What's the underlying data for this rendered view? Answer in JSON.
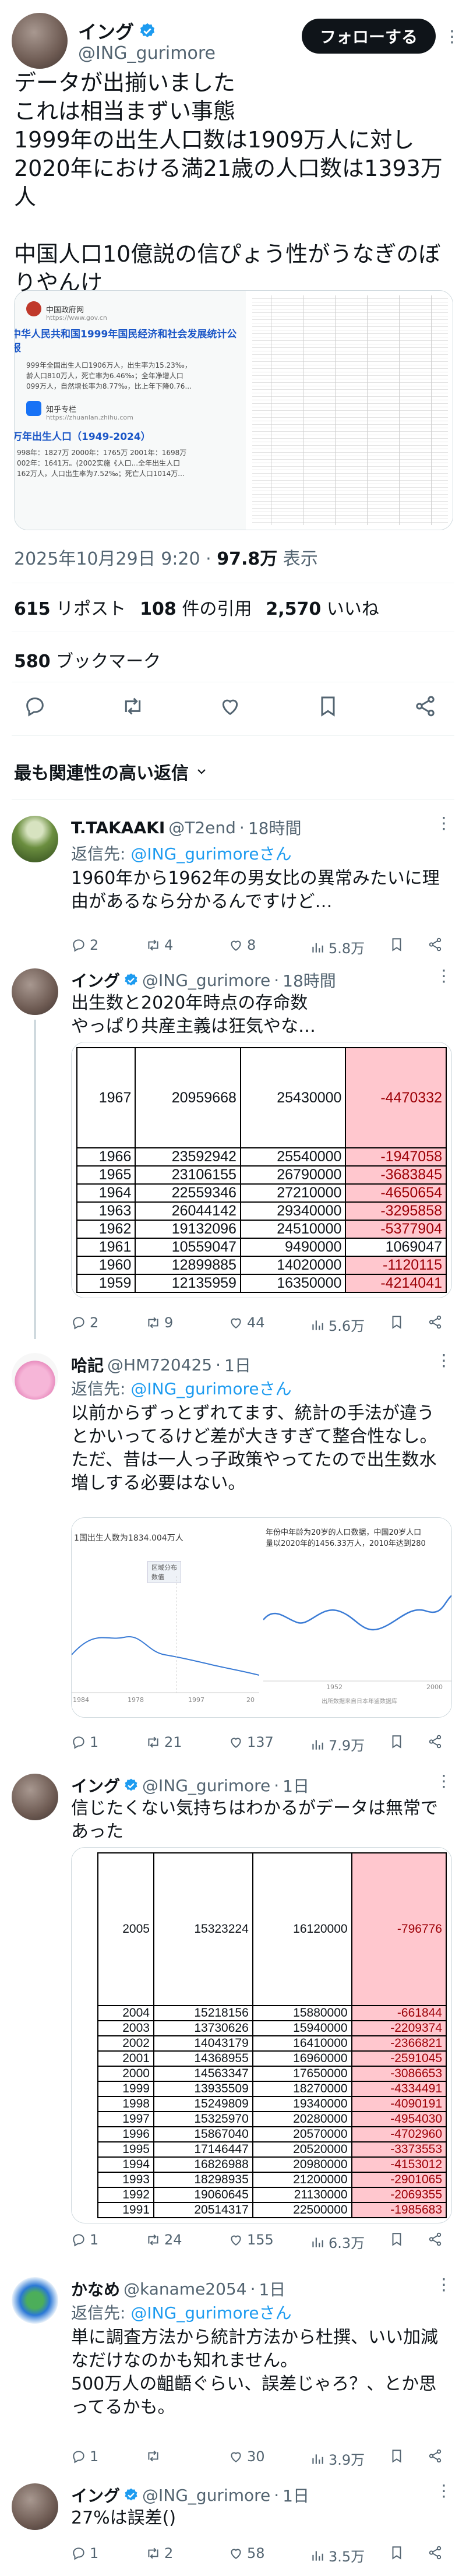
{
  "main": {
    "author_name": "イング",
    "author_handle": "@ING_gurimore",
    "follow_label": "フォローする",
    "text": "データが出揃いました\nこれは相当まずい事態\n1999年の出生人口数は1909万人に対し\n2020年における満21歳の人口数は1393万人\n\n中国人口10億説の信ぴょう性がうなぎのぼりやんけ",
    "timestamp": "2025年10月29日 9:20",
    "views": "97.8万",
    "views_label": "表示",
    "reposts": "615",
    "reposts_label": "リポスト",
    "quotes": "108",
    "quotes_label": "件の引用",
    "likes": "2,570",
    "likes_label": "いいね",
    "bookmarks": "580",
    "bookmarks_label": "ブックマーク",
    "media_left": {
      "site_name": "中国政府网",
      "site_url": "https://www.gov.cn",
      "title": "中华人民共和国1999年国民经济和社会发展统计公报",
      "body": "999年全国出生人口1906万人，出生率为15.23‰，\n龄人口810万人，死亡率为6.46‰；全年净增人口\n099万人，自然增长率为8.77‰，比上年下降0.76...",
      "site2_name": "知乎专栏",
      "site2_url": "https://zhuanlan.zhihu.com",
      "title2": "万年出生人口（1949-2024）",
      "body2": "998年：1827万 2000年：1765万 2001年：1698万\n002年：1641万。(2002实施《人口...全年出生人口\n162万人，人口出生率为7.52‰；死亡人口1014万..."
    }
  },
  "section_title": "最も関連性の高い返信",
  "replies": [
    {
      "name": "T.TAKAAKI",
      "handle": "@T2end",
      "time": "18時間",
      "reply_to_label": "返信先: ",
      "reply_to": "@ING_gurimoreさん",
      "text": "1960年から1962年の男女比の異常みたいに理由があるなら分かるんですけど…",
      "replies": "2",
      "reposts": "4",
      "likes": "8",
      "views": "5.8万"
    },
    {
      "name": "イング",
      "handle": "@ING_gurimore",
      "time": "18時間",
      "text": "出生数と2020年時点の存命数\nやっぱり共産主義は狂気やな…",
      "replies": "2",
      "reposts": "9",
      "likes": "44",
      "views": "5.6万",
      "table": [
        [
          "1967",
          "20959668",
          "25430000",
          "-4470332"
        ],
        [
          "1966",
          "23592942",
          "25540000",
          "-1947058"
        ],
        [
          "1965",
          "23106155",
          "26790000",
          "-3683845"
        ],
        [
          "1964",
          "22559346",
          "27210000",
          "-4650654"
        ],
        [
          "1963",
          "26044142",
          "29340000",
          "-3295858"
        ],
        [
          "1962",
          "19132096",
          "24510000",
          "-5377904"
        ],
        [
          "1961",
          "10559047",
          "9490000",
          "1069047"
        ],
        [
          "1960",
          "12899885",
          "14020000",
          "-1120115"
        ],
        [
          "1959",
          "12135959",
          "16350000",
          "-4214041"
        ]
      ]
    },
    {
      "name": "哈記",
      "handle": "@HM720425",
      "time": "1日",
      "reply_to_label": "返信先: ",
      "reply_to": "@ING_gurimoreさん",
      "text": "以前からずっとずれてます、統計の手法が違うとかいってるけど差が大きすぎて整合性なし。\nただ、昔は一人っ子政策やってたので出生数水増しする必要はない。",
      "replies": "1",
      "reposts": "21",
      "likes": "137",
      "views": "7.9万",
      "chart_left": {
        "title": "1国出生人数为1834.004万人",
        "label": "区域分布\n数值",
        "ticks": [
          "1984",
          "1978",
          "1997",
          "20"
        ]
      },
      "chart_right": {
        "title": "年份中年龄为20岁的人口数据，中国20岁人口\n量以2020年的1456.33万人，2010年达到280",
        "ticks": [
          "1952",
          "2000"
        ],
        "note": "出所数据来自日本年鉴数据库"
      }
    },
    {
      "name": "イング",
      "handle": "@ING_gurimore",
      "time": "1日",
      "text": "信じたくない気持ちはわかるがデータは無常であった",
      "replies": "1",
      "reposts": "24",
      "likes": "155",
      "views": "6.3万",
      "table": [
        [
          "2005",
          "15323224",
          "16120000",
          "-796776"
        ],
        [
          "2004",
          "15218156",
          "15880000",
          "-661844"
        ],
        [
          "2003",
          "13730626",
          "15940000",
          "-2209374"
        ],
        [
          "2002",
          "14043179",
          "16410000",
          "-2366821"
        ],
        [
          "2001",
          "14368955",
          "16960000",
          "-2591045"
        ],
        [
          "2000",
          "14563347",
          "17650000",
          "-3086653"
        ],
        [
          "1999",
          "13935509",
          "18270000",
          "-4334491"
        ],
        [
          "1998",
          "15249809",
          "19340000",
          "-4090191"
        ],
        [
          "1997",
          "15325970",
          "20280000",
          "-4954030"
        ],
        [
          "1996",
          "15867040",
          "20570000",
          "-4702960"
        ],
        [
          "1995",
          "17146447",
          "20520000",
          "-3373553"
        ],
        [
          "1994",
          "16826988",
          "20980000",
          "-4153012"
        ],
        [
          "1993",
          "18298935",
          "21200000",
          "-2901065"
        ],
        [
          "1992",
          "19060645",
          "21130000",
          "-2069355"
        ],
        [
          "1991",
          "20514317",
          "22500000",
          "-1985683"
        ]
      ]
    },
    {
      "name": "かなめ",
      "handle": "@kaname2054",
      "time": "1日",
      "reply_to_label": "返信先: ",
      "reply_to": "@ING_gurimoreさん",
      "text": "単に調査方法から統計方法から杜撰、いい加減なだけなのかも知れません。\n500万人の齟齬ぐらい、誤差じゃろ？、とか思ってるかも。",
      "replies": "1",
      "reposts": "",
      "likes": "30",
      "views": "3.9万"
    },
    {
      "name": "イング",
      "handle": "@ING_gurimore",
      "time": "1日",
      "text": "27%は誤差()",
      "replies": "1",
      "reposts": "2",
      "likes": "58",
      "views": "3.5万"
    }
  ],
  "colors": {
    "verified": "#1d9bf0",
    "negative_fill": "#ffc7ce",
    "negative_text": "#9c0006",
    "link": "#1d9bf0"
  }
}
